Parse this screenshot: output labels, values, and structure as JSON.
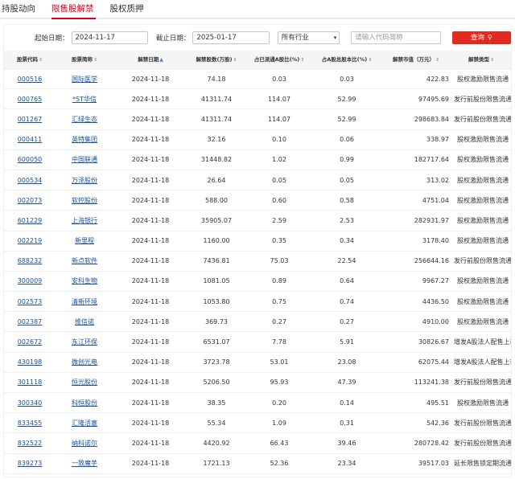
{
  "tabs": [
    {
      "label": "持股动向",
      "active": false
    },
    {
      "label": "限售股解禁",
      "active": true
    },
    {
      "label": "股权质押",
      "active": false
    }
  ],
  "filters": {
    "start_label": "起始日期：",
    "start_value": "2024-11-17",
    "end_label": "截止日期：",
    "end_value": "2025-01-17",
    "industry_value": "所有行业",
    "search_placeholder": "请输入代码简称",
    "query_label": "查询"
  },
  "table": {
    "headers": [
      "股票代码",
      "股票简称",
      "解禁日期",
      "解禁股数(万股)",
      "占已流通A股比(%)",
      "占A股总股本比(%)",
      "解禁市值（万元）",
      "解禁类型"
    ],
    "rows": [
      [
        "000516",
        "国际医学",
        "2024-11-18",
        "74.18",
        "0.03",
        "0.03",
        "422.83",
        "股权激励限售流通"
      ],
      [
        "000765",
        "*ST华信",
        "2024-11-18",
        "41311.74",
        "114.07",
        "52.99",
        "97495.69",
        "发行前股份限售流通"
      ],
      [
        "001267",
        "汇绿生态",
        "2024-11-18",
        "41311.74",
        "114.07",
        "52.99",
        "298683.84",
        "发行前股份限售流通"
      ],
      [
        "000411",
        "英特集团",
        "2024-11-18",
        "32.16",
        "0.10",
        "0.06",
        "338.97",
        "股权激励限售流通"
      ],
      [
        "600050",
        "中国联通",
        "2024-11-18",
        "31448.82",
        "1.02",
        "0.99",
        "182717.64",
        "股权激励限售流通"
      ],
      [
        "000534",
        "万泽股份",
        "2024-11-18",
        "26.64",
        "0.05",
        "0.05",
        "313.02",
        "股权激励限售流通"
      ],
      [
        "002073",
        "软控股份",
        "2024-11-18",
        "588.00",
        "0.60",
        "0.58",
        "4751.04",
        "股权激励限售流通"
      ],
      [
        "601229",
        "上海银行",
        "2024-11-18",
        "35905.07",
        "2.59",
        "2.53",
        "282931.97",
        "股权激励限售流通"
      ],
      [
        "002219",
        "新里程",
        "2024-11-18",
        "1160.00",
        "0.35",
        "0.34",
        "3178.40",
        "股权激励限售流通"
      ],
      [
        "688232",
        "新点软件",
        "2024-11-18",
        "7436.81",
        "75.03",
        "22.54",
        "256644.16",
        "发行前股份限售流通"
      ],
      [
        "300009",
        "安科生物",
        "2024-11-18",
        "1081.05",
        "0.89",
        "0.64",
        "9967.27",
        "股权激励限售流通"
      ],
      [
        "002573",
        "清新环境",
        "2024-11-18",
        "1053.80",
        "0.75",
        "0.74",
        "4436.50",
        "股权激励限售流通"
      ],
      [
        "002387",
        "维信诺",
        "2024-11-18",
        "369.73",
        "0.27",
        "0.27",
        "4910.00",
        "股权激励限售流通"
      ],
      [
        "002672",
        "东江环保",
        "2024-11-18",
        "6531.07",
        "7.78",
        "5.91",
        "30826.67",
        "增发A股法人配售上市"
      ],
      [
        "430198",
        "微创光电",
        "2024-11-18",
        "3723.78",
        "53.01",
        "23.08",
        "62075.44",
        "增发A股法人配售上市"
      ],
      [
        "301118",
        "恒光股份",
        "2024-11-18",
        "5206.50",
        "95.93",
        "47.39",
        "113241.38",
        "发行前股份限售流通"
      ],
      [
        "300340",
        "科恒股份",
        "2024-11-18",
        "38.35",
        "0.20",
        "0.14",
        "495.51",
        "股权激励限售流通"
      ],
      [
        "833455",
        "汇隆活塞",
        "2024-11-18",
        "55.34",
        "1.09",
        "0.31",
        "542.36",
        "发行前股份限售流通"
      ],
      [
        "832522",
        "纳科诺尔",
        "2024-11-18",
        "4420.92",
        "66.43",
        "39.46",
        "280728.42",
        "发行前股份限售流通"
      ],
      [
        "839273",
        "一致魔芋",
        "2024-11-18",
        "1721.13",
        "52.36",
        "23.34",
        "39517.03",
        "延长限售锁定期流通"
      ]
    ]
  }
}
